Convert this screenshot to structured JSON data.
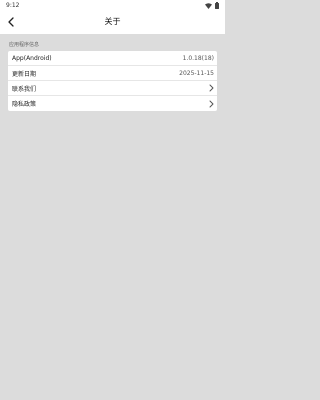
{
  "status_bar": {
    "time": "9:12",
    "icons": [
      "wifi-icon",
      "battery-icon"
    ]
  },
  "header": {
    "title": "关于",
    "back_icon": "back-arrow-icon"
  },
  "section": {
    "label": "应用程序信息"
  },
  "rows": [
    {
      "label": "App(Android)",
      "value": "1.0.18(18)"
    },
    {
      "label": "更新日期",
      "value": "2025-11-15"
    },
    {
      "label": "联系我们",
      "icon": "chevron-right-icon"
    },
    {
      "label": "隐私政策",
      "icon": "chevron-right-icon"
    }
  ],
  "colors": {
    "background": "#dcdcdc",
    "surface": "#ffffff",
    "text": "#222222"
  }
}
